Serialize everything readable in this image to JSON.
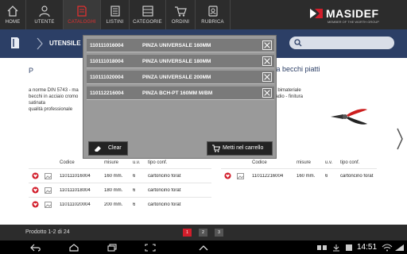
{
  "nav": {
    "items": [
      {
        "label": "HOME",
        "icon": "home-icon"
      },
      {
        "label": "UTENTE",
        "icon": "user-icon"
      },
      {
        "label": "CATALOGHI",
        "icon": "catalog-icon"
      },
      {
        "label": "LISTINI",
        "icon": "list-icon"
      },
      {
        "label": "CATEGORIE",
        "icon": "categories-icon"
      },
      {
        "label": "ORDINI",
        "icon": "cart-icon"
      },
      {
        "label": "RUBRICA",
        "icon": "addressbook-icon"
      }
    ],
    "active_index": 2,
    "active_color": "#e03030"
  },
  "brand": {
    "name": "MASIDEF",
    "tagline": "MEMBER OF THE WÜRTH GROUP",
    "color": "#d21e2b"
  },
  "subbar": {
    "crumb": "UTENSILE"
  },
  "content": {
    "title_left": "P",
    "title_right": "za becchi piatti",
    "desc_left": [
      "a norme DIN 5743 - ma",
      "becchi in acciaio cromo",
      "satinata",
      "qualità professionale"
    ],
    "desc_right": [
      "in bimateriale",
      "nadio - finitura"
    ]
  },
  "table_left": {
    "headers": [
      "Codice",
      "misure",
      "u.v.",
      "tipo conf."
    ],
    "rows": [
      [
        "110111016004",
        "160 mm.",
        "6",
        "cartoncino forat"
      ],
      [
        "110111018004",
        "180 mm.",
        "6",
        "cartoncino forat"
      ],
      [
        "110111020004",
        "200 mm.",
        "6",
        "cartoncino forat"
      ]
    ]
  },
  "table_right": {
    "headers": [
      "Codice",
      "misure",
      "u.v.",
      "tipo conf."
    ],
    "rows": [
      [
        "110112216004",
        "160 mm.",
        "6",
        "cartoncino forat"
      ]
    ]
  },
  "footer": {
    "count": "Prodotto 1-2 di 24",
    "pages": [
      "1",
      "2",
      "3"
    ],
    "active_page": 0
  },
  "popup": {
    "items": [
      {
        "code": "110111016004",
        "name": "PINZA UNIVERSALE 160MM"
      },
      {
        "code": "110111018004",
        "name": "PINZA UNIVERSALE 180MM"
      },
      {
        "code": "110111020004",
        "name": "PINZA UNIVERSALE 200MM"
      },
      {
        "code": "110112216004",
        "name": "PINZA BCH-PT 160MM M/BM"
      }
    ],
    "clear_label": "Clear",
    "cart_label": "Metti nel carrello"
  },
  "system": {
    "time": "14:51"
  }
}
